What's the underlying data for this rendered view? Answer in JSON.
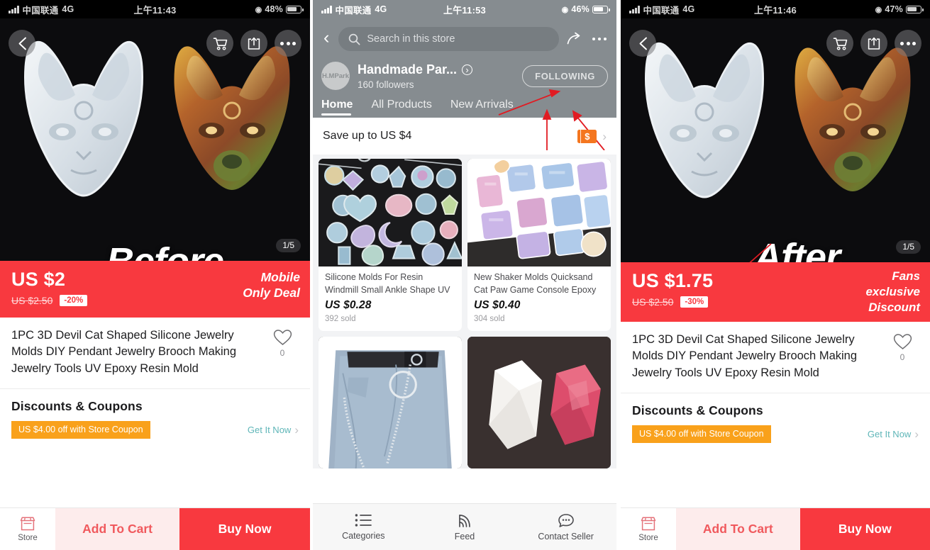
{
  "left_phone": {
    "status": {
      "carrier": "中国联通",
      "network": "4G",
      "time": "上午11:43",
      "battery": "48%"
    },
    "nav": {
      "back_icon": "chevron-left-icon",
      "cart_icon": "cart-icon",
      "share_icon": "share-icon",
      "more_icon": "more-icon"
    },
    "hero": {
      "overlay_word": "Before",
      "page_indicator": "1/5"
    },
    "price": {
      "current": "US $2",
      "original": "US $2.50",
      "discount": "-20%",
      "tag_line1": "Mobile",
      "tag_line2": "Only Deal"
    },
    "product": {
      "title": "1PC 3D Devil Cat Shaped Silicone Jewelry Molds DIY Pendant Jewelry Brooch Making Jewelry Tools UV Epoxy Resin Mold",
      "fav_count": "0"
    },
    "coupons": {
      "heading": "Discounts & Coupons",
      "chip": "US $4.00 off with Store Coupon",
      "cta": "Get It Now"
    },
    "actions": {
      "store": "Store",
      "add_to_cart": "Add To Cart",
      "buy_now": "Buy Now"
    }
  },
  "mid_phone": {
    "status": {
      "carrier": "中国联通",
      "network": "4G",
      "time": "上午11:53",
      "battery": "46%"
    },
    "search": {
      "placeholder": "Search in this store",
      "icon": "search-icon"
    },
    "store": {
      "avatar_text": "H.MPark",
      "name": "Handmade Par...",
      "followers": "160  followers",
      "follow_button": "FOLLOWING"
    },
    "tabs": [
      {
        "label": "Home",
        "active": true
      },
      {
        "label": "All Products",
        "active": false
      },
      {
        "label": "New Arrivals",
        "active": false
      }
    ],
    "save_banner": {
      "text": "Save up to US $4"
    },
    "products": [
      {
        "title": "Silicone Molds For Resin Windmill Small Ankle Shape UV ...",
        "price": "US $0.28",
        "sold": "392 sold"
      },
      {
        "title": "New Shaker Molds Quicksand Cat Paw Game Console Epoxy ...",
        "price": "US $0.40",
        "sold": "304 sold"
      }
    ],
    "tabbar": [
      {
        "label": "Categories",
        "icon": "list-icon"
      },
      {
        "label": "Feed",
        "icon": "rss-icon"
      },
      {
        "label": "Contact Seller",
        "icon": "chat-icon"
      }
    ]
  },
  "right_phone": {
    "status": {
      "carrier": "中国联通",
      "network": "4G",
      "time": "上午11:46",
      "battery": "47%"
    },
    "hero": {
      "overlay_word": "After",
      "page_indicator": "1/5"
    },
    "price": {
      "current": "US $1.75",
      "original": "US $2.50",
      "discount": "-30%",
      "tag_line1": "Fans",
      "tag_line2": "exclusive",
      "tag_line3": "Discount"
    },
    "product": {
      "title": "1PC 3D Devil Cat Shaped Silicone Jewelry Molds DIY Pendant Jewelry Brooch Making Jewelry Tools UV Epoxy Resin Mold",
      "fav_count": "0"
    },
    "coupons": {
      "heading": "Discounts & Coupons",
      "chip": "US $4.00 off with Store Coupon",
      "cta": "Get It Now"
    },
    "actions": {
      "store": "Store",
      "add_to_cart": "Add To Cart",
      "buy_now": "Buy Now"
    }
  },
  "colors": {
    "price_red": "#f8393f",
    "coupon_orange": "#f9a11b",
    "store_grey": "#868c90",
    "annotation_red": "#e11b22",
    "teal_link": "#5fb6b8"
  }
}
